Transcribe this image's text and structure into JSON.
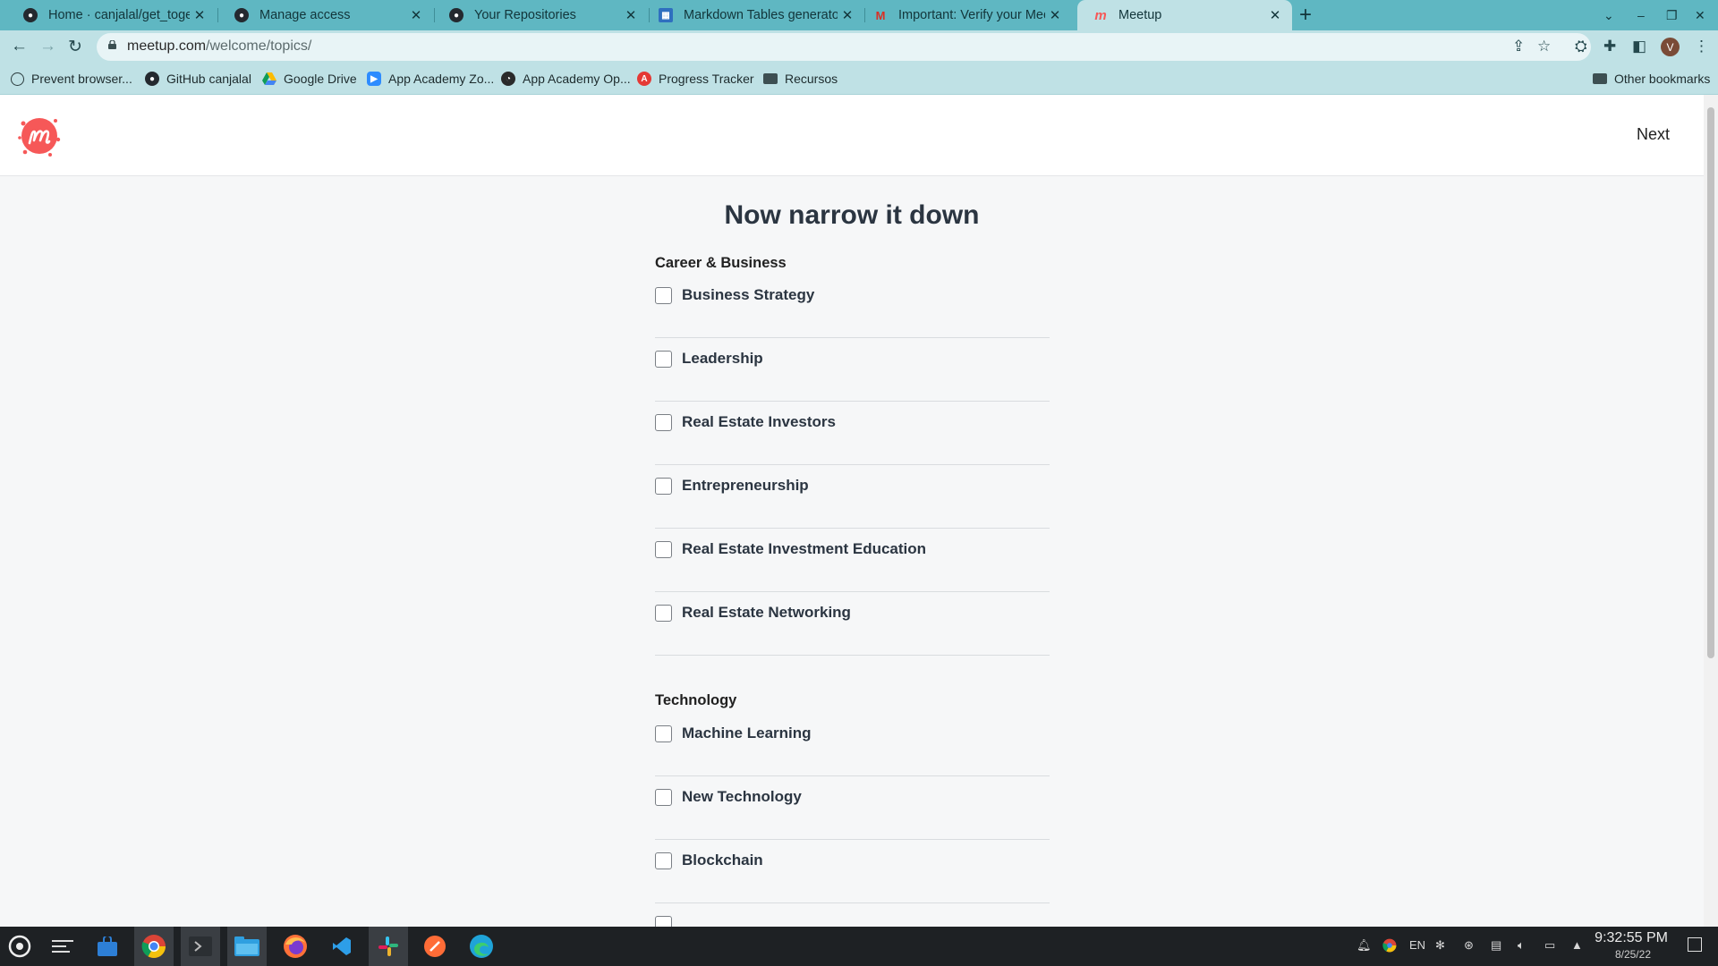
{
  "browser": {
    "tabs": [
      {
        "title": "Home · canjalal/get_together",
        "favicon": "github-icon",
        "active": false
      },
      {
        "title": "Manage access",
        "favicon": "github-icon",
        "active": false
      },
      {
        "title": "Your Repositories",
        "favicon": "github-icon",
        "active": false
      },
      {
        "title": "Markdown Tables generator -",
        "favicon": "table-icon",
        "active": false
      },
      {
        "title": "Important: Verify your Meetu",
        "favicon": "gmail-icon",
        "active": false
      },
      {
        "title": "Meetup",
        "favicon": "meetup-icon",
        "active": true
      }
    ],
    "url_host": "meetup.com",
    "url_path": "/welcome/topics/",
    "profile_initial": "V",
    "bookmarks": [
      {
        "label": "Prevent browser...",
        "icon": "cloud-icon"
      },
      {
        "label": "GitHub canjalal",
        "icon": "github-icon"
      },
      {
        "label": "Google Drive",
        "icon": "google-drive-icon"
      },
      {
        "label": "App Academy Zo...",
        "icon": "zoom-icon"
      },
      {
        "label": "App Academy Op...",
        "icon": "open-icon"
      },
      {
        "label": "Progress Tracker",
        "icon": "progress-icon"
      },
      {
        "label": "Recursos",
        "icon": "folder-icon"
      }
    ],
    "other_bookmarks": "Other bookmarks"
  },
  "page": {
    "next_label": "Next",
    "heading": "Now narrow it down",
    "sections": [
      {
        "title": "Career & Business",
        "topics": [
          "Business Strategy",
          "Leadership",
          "Real Estate Investors",
          "Entrepreneurship",
          "Real Estate Investment Education",
          "Real Estate Networking"
        ]
      },
      {
        "title": "Technology",
        "topics": [
          "Machine Learning",
          "New Technology",
          "Blockchain"
        ]
      }
    ]
  },
  "taskbar": {
    "language": "EN",
    "time": "9:32:55 PM",
    "date": "8/25/22"
  },
  "colors": {
    "tab_strip": "#5fb7c2",
    "toolbar": "#bfe1e5",
    "meetup_brand": "#f65858",
    "page_background": "#f6f7f8"
  }
}
